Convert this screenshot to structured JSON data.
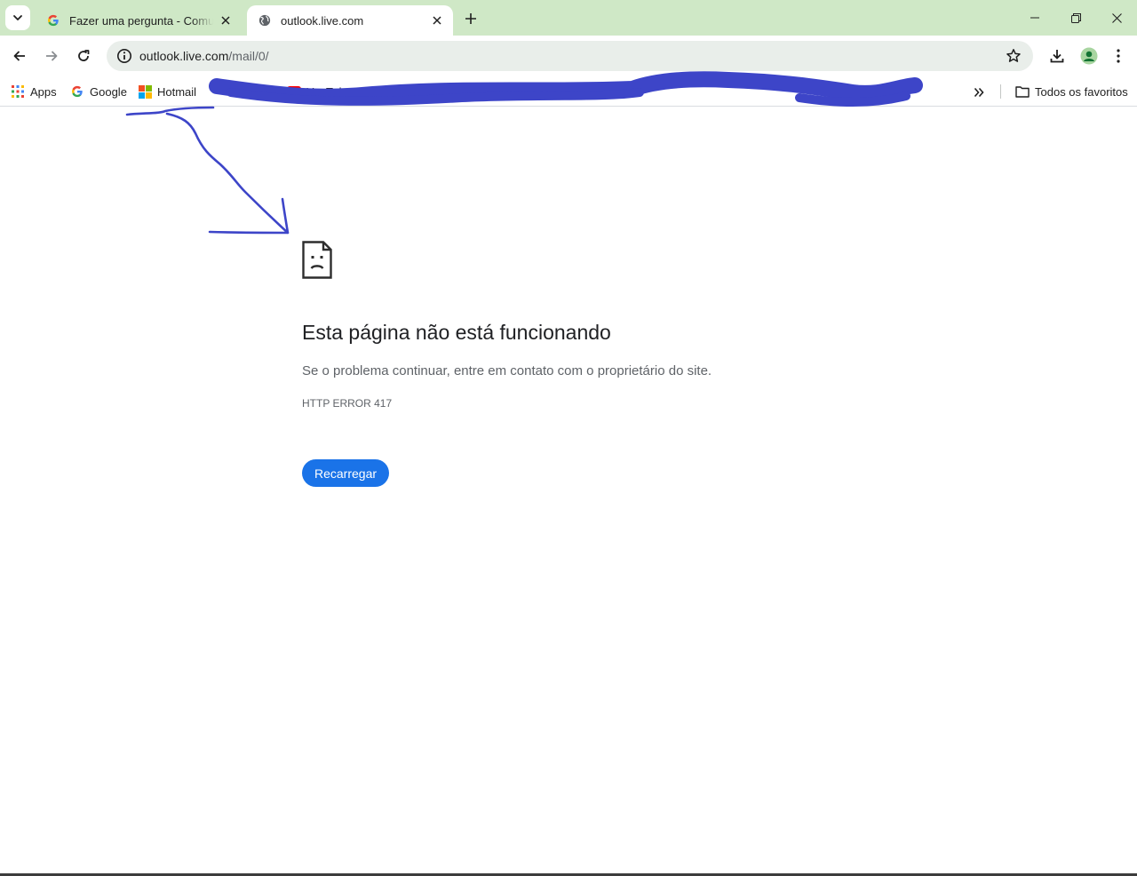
{
  "tabs": [
    {
      "title": "Fazer uma pergunta - Comunidade",
      "favicon": "google-icon",
      "active": false
    },
    {
      "title": "outlook.live.com",
      "favicon": "globe-icon",
      "active": true
    }
  ],
  "toolbar": {
    "url_host": "outlook.live.com",
    "url_path": "/mail/0/"
  },
  "bookmarks": {
    "items": [
      {
        "label": "Apps",
        "icon": "apps-grid-icon"
      },
      {
        "label": "Google",
        "icon": "google-icon"
      },
      {
        "label": "Hotmail",
        "icon": "microsoft-icon"
      },
      {
        "label": "YouTube Kids",
        "icon": "youtube-icon"
      }
    ],
    "all_bookmarks_label": "Todos os favoritos"
  },
  "error": {
    "title": "Esta página não está funcionando",
    "description": "Se o problema continuar, entre em contato com o proprietário do site.",
    "code": "HTTP ERROR 417",
    "reload_label": "Recarregar"
  },
  "colors": {
    "tabstrip": "#cfe8c6",
    "accent": "#1a73e8",
    "annotation": "#3d45c8"
  }
}
